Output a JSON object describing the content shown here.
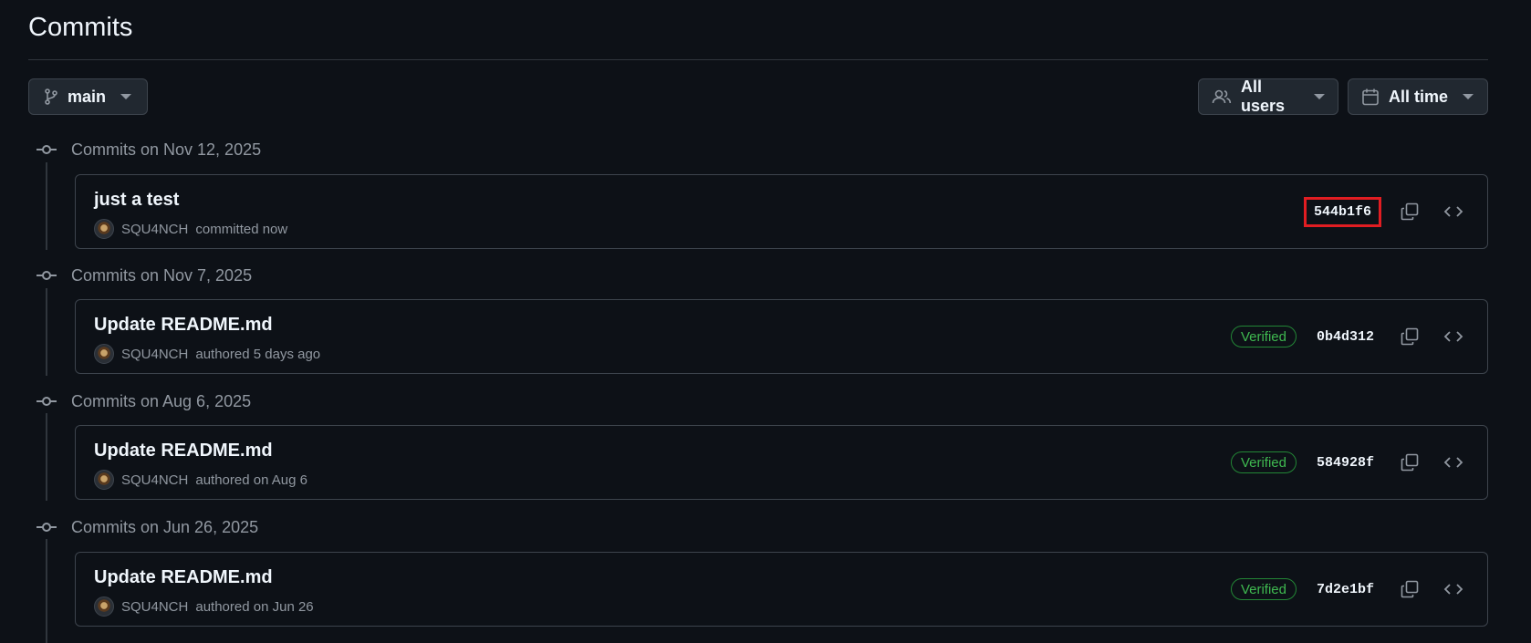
{
  "page": {
    "title": "Commits"
  },
  "toolbar": {
    "branch_label": "main",
    "users_label": "All users",
    "time_label": "All time"
  },
  "groups": [
    {
      "heading": "Commits on Nov 12, 2025",
      "commit": {
        "message": "just a test",
        "author": "SQU4NCH",
        "action": "committed now",
        "verified": "",
        "sha": "544b1f6"
      }
    },
    {
      "heading": "Commits on Nov 7, 2025",
      "commit": {
        "message": "Update README.md",
        "author": "SQU4NCH",
        "action": "authored 5 days ago",
        "verified": "Verified",
        "sha": "0b4d312"
      }
    },
    {
      "heading": "Commits on Aug 6, 2025",
      "commit": {
        "message": "Update README.md",
        "author": "SQU4NCH",
        "action": "authored on Aug 6",
        "verified": "Verified",
        "sha": "584928f"
      }
    },
    {
      "heading": "Commits on Jun 26, 2025",
      "commit": {
        "message": "Update README.md",
        "author": "SQU4NCH",
        "action": "authored on Jun 26",
        "verified": "Verified",
        "sha": "7d2e1bf"
      }
    }
  ],
  "colors": {
    "background": "#0d1117",
    "verified": "#3fb950",
    "highlight_box": "#e11d22"
  },
  "icons": {
    "branch": "git-branch-icon",
    "users": "people-icon",
    "time": "calendar-icon",
    "copy": "copy-icon",
    "browse": "code-icon"
  }
}
